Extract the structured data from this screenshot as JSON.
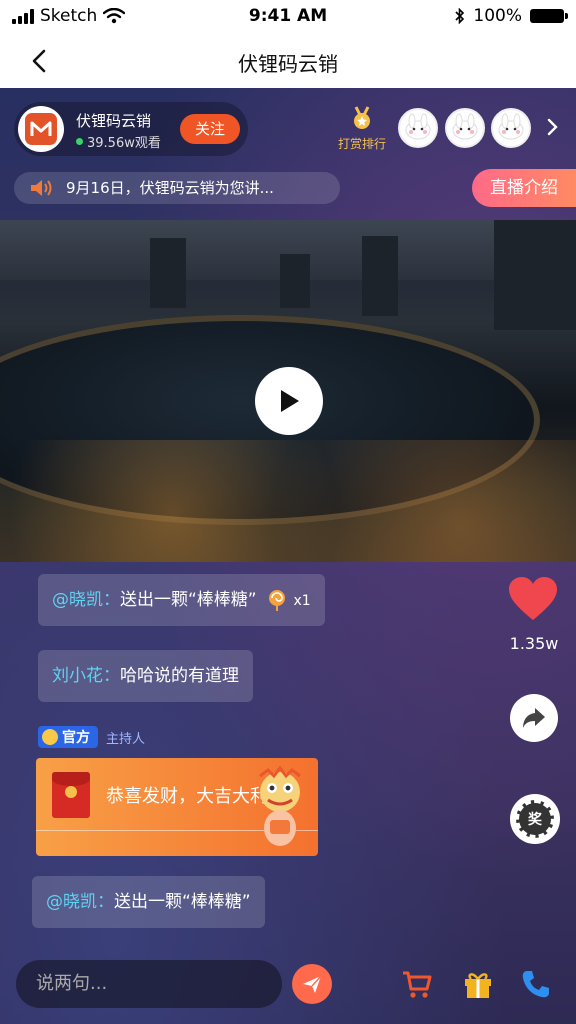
{
  "status_bar": {
    "carrier": "Sketch",
    "time": "9:41 AM",
    "battery": "100%"
  },
  "nav": {
    "title": "伏锂码云销"
  },
  "host": {
    "name": "伏锂码云销",
    "viewers": "39.56w观看",
    "follow_label": "关注"
  },
  "ranking": {
    "label": "打赏排行"
  },
  "notice": {
    "text": "9月16日，伏锂码云销为您讲..."
  },
  "intro_button": "直播介绍",
  "chat": [
    {
      "user": "@晓凯：",
      "text": "送出一颗“棒棒糖”",
      "count": "x1"
    },
    {
      "user": "刘小花：",
      "text": "哈哈说的有道理"
    },
    {
      "user": "@晓凯：",
      "text": "送出一颗“棒棒糖”"
    }
  ],
  "official": {
    "badge": "官方",
    "role": "主持人"
  },
  "red_packet": {
    "text": "恭喜发财，大吉大利",
    "coin_symbol": "¥"
  },
  "likes": {
    "count": "1.35w"
  },
  "prize": {
    "label": "奖"
  },
  "input": {
    "placeholder": "说两句..."
  },
  "colors": {
    "accent": "#f05526",
    "heart": "#f0474e",
    "username": "#5fd4f2",
    "intro_gradient": "#ff6a88"
  }
}
